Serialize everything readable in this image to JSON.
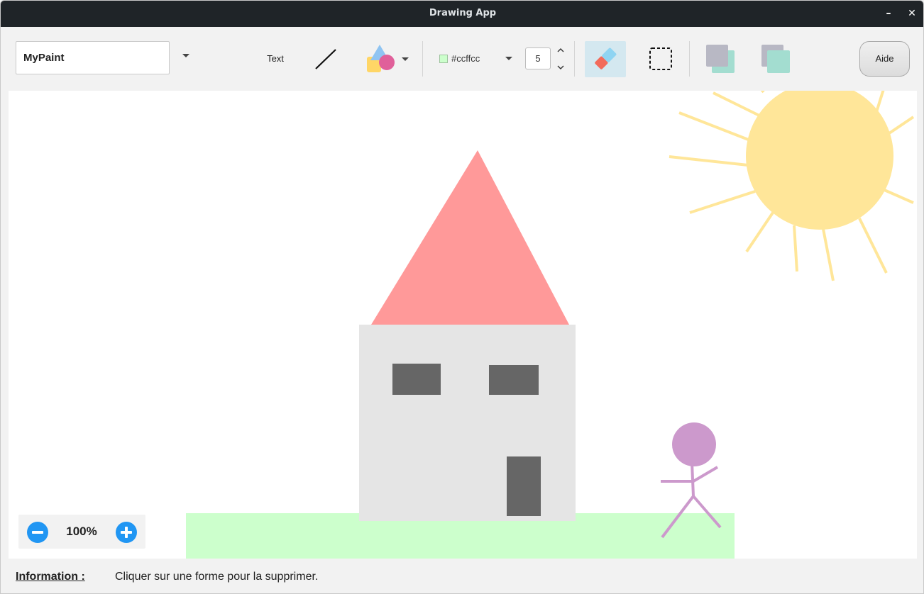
{
  "window": {
    "title": "Drawing App",
    "minimize_label": "–",
    "close_label": "✕"
  },
  "toolbar": {
    "name_value": "MyPaint",
    "text_tool_label": "Text",
    "color_value": "#ccffcc",
    "stroke_size": "5",
    "help_label": "Aide",
    "tools": [
      "text-tool",
      "line-icon",
      "shapes-icon",
      "eraser-icon",
      "selection-icon",
      "bring-to-front-icon",
      "send-to-back-icon"
    ]
  },
  "zoom": {
    "label": "100%"
  },
  "status": {
    "label": "Information :",
    "message": "Cliquer sur une forme pour la supprimer."
  },
  "colors": {
    "titlebar": "#1f2428",
    "roof": "#ff9999",
    "house": "#e5e5e5",
    "windows_door": "#666666",
    "grass": "#ccffcc",
    "sun": "#ffe699",
    "stickman": "#cc99cc",
    "accent": "#2196f3"
  }
}
